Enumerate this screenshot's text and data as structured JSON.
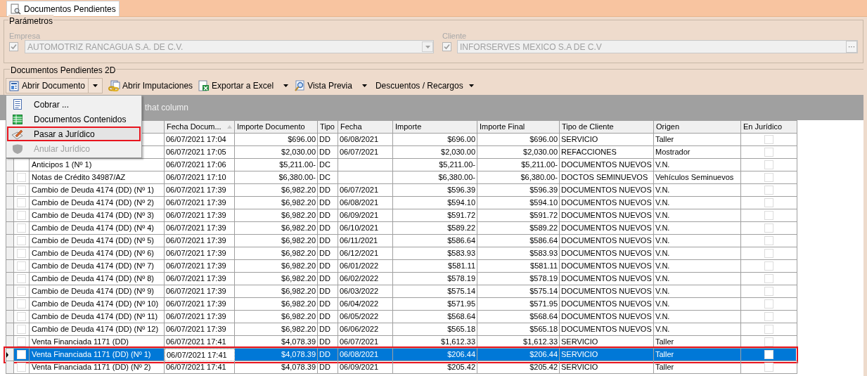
{
  "tab": {
    "title": "Documentos Pendientes"
  },
  "parameters": {
    "title": "Parámetros",
    "empresa": {
      "label": "Empresa",
      "checked": true,
      "value": "AUTOMOTRIZ RANCAGUA S.A. DE C.V."
    },
    "cliente": {
      "label": "Cliente",
      "checked": true,
      "value": "INFORSERVES MEXICO S.A DE C.V",
      "button": "···"
    }
  },
  "group_title": "Documentos Pendientes 2D",
  "toolbar": [
    {
      "kind": "split",
      "label": "Abrir Documento"
    },
    {
      "kind": "button",
      "label": "Abrir Imputaciones"
    },
    {
      "kind": "dropdown",
      "label": "Exportar a Excel"
    },
    {
      "kind": "dropdown",
      "label": "Vista Previa"
    },
    {
      "kind": "text-dropdown",
      "label": "Descuentos / Recargos"
    }
  ],
  "group_panel_text": "that column",
  "menu": [
    {
      "label": "Cobrar ...",
      "disabled": false,
      "highlighted": false
    },
    {
      "label": "Documentos Contenidos",
      "disabled": false,
      "highlighted": false
    },
    {
      "label": "Pasar a Jurídico",
      "disabled": false,
      "highlighted": true
    },
    {
      "label": "Anular Jurídico",
      "disabled": true,
      "highlighted": false
    }
  ],
  "columns": [
    {
      "label": "Fecha Docum...",
      "sorted": true
    },
    {
      "label": "Importe Documento",
      "sorted": false
    },
    {
      "label": "Tipo",
      "sorted": false
    },
    {
      "label": "Fecha",
      "sorted": false
    },
    {
      "label": "Importe",
      "sorted": false
    },
    {
      "label": "Importe Final",
      "sorted": false
    },
    {
      "label": "Tipo de Cliente",
      "sorted": false
    },
    {
      "label": "Origen",
      "sorted": false
    },
    {
      "label": "En Jurídico",
      "sorted": false
    }
  ],
  "rows": [
    {
      "selected": false,
      "en_juridico": false,
      "cells": [
        "06/07/2021 17:04",
        "$696.00",
        "DD",
        "06/08/2021",
        "$696.00",
        "$696.00",
        "SERVICIO",
        "Taller"
      ]
    },
    {
      "selected": false,
      "en_juridico": false,
      "cells": [
        "06/07/2021 17:05",
        "$2,030.00",
        "DD",
        "06/07/2021",
        "$2,030.00",
        "$2,030.00",
        "REFACCIONES",
        "Mostrador"
      ]
    },
    {
      "selected": false,
      "en_juridico": false,
      "documento": "Anticipos 1 (Nº 1)",
      "cells": [
        "06/07/2021 17:06",
        "$5,211.00-",
        "DC",
        null,
        "$5,211.00-",
        "$5,211.00-",
        "DOCUMENTOS NUEVOS",
        "V.N."
      ]
    },
    {
      "selected": false,
      "checked": false,
      "en_juridico": false,
      "documento": "Notas de Crédito 34987/AZ",
      "cells": [
        "06/07/2021 17:10",
        "$6,380.00-",
        "DC",
        null,
        "$6,380.00-",
        "$6,380.00-",
        "DOCTOS SEMINUEVOS",
        "Vehículos Seminuevos"
      ]
    },
    {
      "selected": false,
      "checked": false,
      "en_juridico": false,
      "documento": "Cambio de Deuda 4174 (DD) (Nº 1)",
      "cells": [
        "06/07/2021 17:39",
        "$6,982.20",
        "DD",
        "06/07/2021",
        "$596.39",
        "$596.39",
        "DOCUMENTOS NUEVOS",
        "V.N."
      ]
    },
    {
      "selected": false,
      "checked": false,
      "en_juridico": false,
      "documento": "Cambio de Deuda 4174 (DD) (Nº 2)",
      "cells": [
        "06/07/2021 17:39",
        "$6,982.20",
        "DD",
        "06/08/2021",
        "$594.10",
        "$594.10",
        "DOCUMENTOS NUEVOS",
        "V.N."
      ]
    },
    {
      "selected": false,
      "checked": false,
      "en_juridico": false,
      "documento": "Cambio de Deuda 4174 (DD) (Nº 3)",
      "cells": [
        "06/07/2021 17:39",
        "$6,982.20",
        "DD",
        "06/09/2021",
        "$591.72",
        "$591.72",
        "DOCUMENTOS NUEVOS",
        "V.N."
      ]
    },
    {
      "selected": false,
      "checked": false,
      "en_juridico": false,
      "documento": "Cambio de Deuda 4174 (DD) (Nº 4)",
      "cells": [
        "06/07/2021 17:39",
        "$6,982.20",
        "DD",
        "06/10/2021",
        "$589.22",
        "$589.22",
        "DOCUMENTOS NUEVOS",
        "V.N."
      ]
    },
    {
      "selected": false,
      "checked": false,
      "en_juridico": false,
      "documento": "Cambio de Deuda 4174 (DD) (Nº 5)",
      "cells": [
        "06/07/2021 17:39",
        "$6,982.20",
        "DD",
        "06/11/2021",
        "$586.64",
        "$586.64",
        "DOCUMENTOS NUEVOS",
        "V.N."
      ]
    },
    {
      "selected": false,
      "checked": false,
      "en_juridico": false,
      "documento": "Cambio de Deuda 4174 (DD) (Nº 6)",
      "cells": [
        "06/07/2021 17:39",
        "$6,982.20",
        "DD",
        "06/12/2021",
        "$583.93",
        "$583.93",
        "DOCUMENTOS NUEVOS",
        "V.N."
      ]
    },
    {
      "selected": false,
      "checked": false,
      "en_juridico": false,
      "documento": "Cambio de Deuda 4174 (DD) (Nº 7)",
      "cells": [
        "06/07/2021 17:39",
        "$6,982.20",
        "DD",
        "06/01/2022",
        "$581.11",
        "$581.11",
        "DOCUMENTOS NUEVOS",
        "V.N."
      ]
    },
    {
      "selected": false,
      "checked": false,
      "en_juridico": false,
      "documento": "Cambio de Deuda 4174 (DD) (Nº 8)",
      "cells": [
        "06/07/2021 17:39",
        "$6,982.20",
        "DD",
        "06/02/2022",
        "$578.19",
        "$578.19",
        "DOCUMENTOS NUEVOS",
        "V.N."
      ]
    },
    {
      "selected": false,
      "checked": false,
      "en_juridico": false,
      "documento": "Cambio de Deuda 4174 (DD) (Nº 9)",
      "cells": [
        "06/07/2021 17:39",
        "$6,982.20",
        "DD",
        "06/03/2022",
        "$575.14",
        "$575.14",
        "DOCUMENTOS NUEVOS",
        "V.N."
      ]
    },
    {
      "selected": false,
      "checked": false,
      "en_juridico": false,
      "documento": "Cambio de Deuda 4174 (DD) (Nº 10)",
      "cells": [
        "06/07/2021 17:39",
        "$6,982.20",
        "DD",
        "06/04/2022",
        "$571.95",
        "$571.95",
        "DOCUMENTOS NUEVOS",
        "V.N."
      ]
    },
    {
      "selected": false,
      "checked": false,
      "en_juridico": false,
      "documento": "Cambio de Deuda 4174 (DD) (Nº 11)",
      "cells": [
        "06/07/2021 17:39",
        "$6,982.20",
        "DD",
        "06/05/2022",
        "$568.64",
        "$568.64",
        "DOCUMENTOS NUEVOS",
        "V.N."
      ]
    },
    {
      "selected": false,
      "checked": false,
      "en_juridico": false,
      "documento": "Cambio de Deuda 4174 (DD) (Nº 12)",
      "cells": [
        "06/07/2021 17:39",
        "$6,982.20",
        "DD",
        "06/06/2022",
        "$565.18",
        "$565.18",
        "DOCUMENTOS NUEVOS",
        "V.N."
      ]
    },
    {
      "selected": false,
      "checked": false,
      "en_juridico": false,
      "documento": "Venta Financiada 1171 (DD)",
      "cells": [
        "06/07/2021 17:41",
        "$4,078.39",
        "DD",
        "06/07/2021",
        "$1,612.33",
        "$1,612.33",
        "SERVICIO",
        "Taller"
      ]
    },
    {
      "selected": true,
      "checked": false,
      "en_juridico": false,
      "documento": "Venta Financiada 1171 (DD) (Nº 1)",
      "cells": [
        "06/07/2021 17:41",
        "$4,078.39",
        "DD",
        "06/08/2021",
        "$206.44",
        "$206.44",
        "SERVICIO",
        "Taller"
      ]
    },
    {
      "selected": false,
      "checked": false,
      "en_juridico": false,
      "documento": "Venta Financiada 1171 (DD) (Nº 2)",
      "cells": [
        "06/07/2021 17:41",
        "$4,078.39",
        "DD",
        "06/09/2021",
        "$205.42",
        "$205.42",
        "SERVICIO",
        "Taller"
      ]
    }
  ]
}
